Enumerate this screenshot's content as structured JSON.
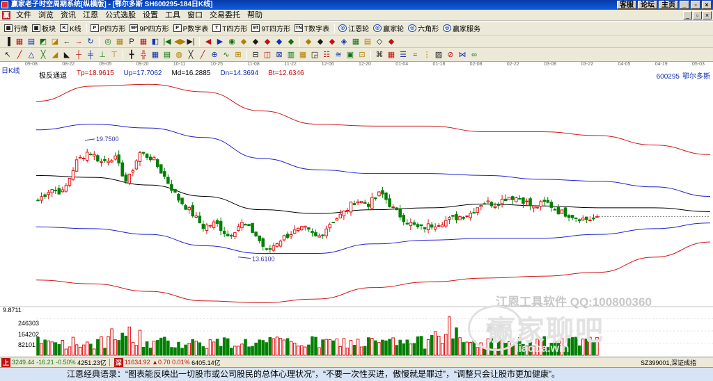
{
  "titlebar": {
    "title": "赢家老子时空周期系统[纵横版] - [鄂尔多斯  SH600295-184日K线]",
    "links": [
      "客服",
      "论坛",
      "主页"
    ]
  },
  "menu": {
    "icon_label": "赢",
    "items": [
      "文件",
      "浏览",
      "资讯",
      "江恩",
      "公式选股",
      "设置",
      "工具",
      "窗口",
      "交易委托",
      "帮助"
    ]
  },
  "toolbar1": {
    "buttons": [
      {
        "icon": "▦",
        "label": "行情"
      },
      {
        "icon": "▦",
        "label": "板块"
      },
      {
        "icon": "K",
        "label": "K线"
      },
      {
        "icon": "P",
        "label": "P四方形"
      },
      {
        "icon": "9P",
        "label": "9P四方形"
      },
      {
        "icon": "P",
        "label": "P数字表"
      },
      {
        "icon": "T",
        "label": "T四方形"
      },
      {
        "icon": "9T",
        "label": "9T四方形"
      },
      {
        "icon": "TN",
        "label": "T数字表"
      },
      {
        "icon": "◎",
        "label": "江恩轮"
      },
      {
        "icon": "◎",
        "label": "赢家轮"
      },
      {
        "icon": "◎",
        "label": "六角形"
      },
      {
        "icon": "◎",
        "label": "赢家服务"
      }
    ]
  },
  "toolbar2_glyphs": [
    "▐",
    "▦",
    "▤",
    "◩",
    "◪",
    "←",
    "→",
    "↻",
    "◎",
    "▦",
    "P",
    "▦",
    "◧",
    "|◀",
    "◀▶",
    "▶|",
    "◀",
    "▶",
    "◉",
    "◆",
    "◆",
    "◆",
    "◆",
    "◆",
    "◆",
    "◆",
    "◆",
    "◈",
    "▦",
    "▤",
    "◇",
    "◆"
  ],
  "toolbar3_glyphs": [
    "↖",
    "╱",
    "△",
    "╳",
    "◢",
    "◣",
    "┼",
    "╪",
    "⊥",
    "⊤",
    "╋",
    "╬",
    "▦",
    "▤",
    "◍",
    "╳",
    "╱",
    "⊕",
    "∿",
    "⊞",
    "⊟",
    "◫",
    "⊠",
    "▥",
    "▦",
    "◲",
    "☷",
    "≋",
    "▣",
    "⊡",
    "⌘",
    "▦",
    "☰",
    "≈",
    "⋮",
    "▨",
    "⊘",
    "⋈",
    "∞"
  ],
  "chart": {
    "period": "日K线",
    "stock_code": "600295",
    "stock_name": "鄂尔多斯",
    "indicator": {
      "name": "极反通道",
      "tp": "Tp=18.9615",
      "up": "Up=17.7062",
      "md": "Md=16.2885",
      "dn": "Dn=14.3694",
      "bt": "Bt=12.6346"
    },
    "dates": [
      "09-08",
      "08-22",
      "09-05",
      "09-20",
      "10-11",
      "10-25",
      "11-08",
      "11-22",
      "12-06",
      "12-20",
      "01-04",
      "01-18",
      "02-08",
      "02-22",
      "03-08",
      "03-22",
      "04-05",
      "04-19",
      "05-03"
    ],
    "high_label": "19.7500",
    "low_label": "13.6100",
    "volume": {
      "max_label": "9.8711",
      "ticks": [
        "246303",
        "164202",
        "82101"
      ]
    },
    "colors": {
      "up": "#e01010",
      "down": "#008000",
      "tp_bt": "#d01818",
      "up_dn": "#2020d0",
      "md": "#000000"
    }
  },
  "chart_data": {
    "type": "candlestick",
    "title": "",
    "xlabel": "",
    "ylabel": "",
    "x": [
      "09-08",
      "08-22",
      "09-05",
      "09-20",
      "10-11",
      "10-25",
      "11-08",
      "11-22",
      "12-06",
      "12-20",
      "01-04",
      "01-18",
      "02-08",
      "02-22",
      "03-08",
      "03-22",
      "04-05",
      "04-19",
      "05-03"
    ],
    "price_ylim": [
      11.0,
      23.0
    ],
    "close_path": [
      16.6,
      17.2,
      17.0,
      18.6,
      19.2,
      18.6,
      18.9,
      17.5,
      19.1,
      18.8,
      17.8,
      16.7,
      16.0,
      15.2,
      15.4,
      14.7,
      15.4,
      14.9,
      13.9,
      14.5,
      14.9,
      15.1,
      14.6,
      15.4,
      15.9,
      16.6,
      16.4,
      17.0,
      16.1,
      15.5,
      15.1,
      15.3,
      15.5,
      15.7,
      15.9,
      16.5,
      16.4,
      16.8,
      16.7,
      16.2,
      16.5,
      16.0,
      15.8,
      15.6,
      15.6
    ],
    "low_point": 13.61,
    "high_point": 19.75,
    "indicator_series": [
      {
        "name": "Tp",
        "values": [
          21.8,
          22.6,
          22.7,
          22.3,
          21.3,
          20.6,
          20.5,
          20.5,
          20.2,
          20.2,
          20.0,
          19.5,
          19.0
        ]
      },
      {
        "name": "Up",
        "values": [
          20.3,
          20.6,
          20.4,
          19.9,
          18.8,
          18.2,
          18.0,
          18.0,
          17.9,
          17.7,
          17.6,
          17.3,
          16.8
        ]
      },
      {
        "name": "Md",
        "values": [
          17.9,
          17.8,
          17.4,
          16.8,
          16.1,
          15.9,
          16.1,
          16.2,
          16.4,
          16.3,
          16.2,
          16.2,
          16.0
        ]
      },
      {
        "name": "Dn",
        "values": [
          15.2,
          15.1,
          14.8,
          14.2,
          13.8,
          13.8,
          14.3,
          14.5,
          14.6,
          14.6,
          14.8,
          15.1,
          15.4
        ]
      },
      {
        "name": "Bt",
        "values": [
          12.4,
          12.2,
          11.8,
          11.3,
          11.2,
          11.4,
          12.0,
          12.3,
          12.5,
          12.6,
          12.8,
          13.6,
          14.4
        ]
      }
    ],
    "volume_ylim": [
      0,
      328404
    ],
    "volume_ticks": [
      82101,
      164202,
      246303
    ]
  },
  "watermark": {
    "line1": "江恩工具软件  QQ:100800360",
    "logo_text": "赢家",
    "line2": "赢家聊吧",
    "line3": "liaoba.win"
  },
  "statusbar": {
    "idx1": "上",
    "sh_value": "3249.44",
    "sh_change": "-16.21",
    "sh_pct": "-0.50%",
    "sh_amount": "4251.23亿",
    "idx2": "深",
    "sz_value": "11634.92",
    "sz_change": "▲0.70",
    "sz_pct": "0.01%",
    "sz_amount": "6405.14亿",
    "right": "SZ399001,深证成指"
  },
  "quote": "江恩经典语录：“图表能反映出一切股市或公司股民的总体心理状况”，“不要一次性买进，傲慢就是罪过”，“调整只会让股市更加健康”。"
}
